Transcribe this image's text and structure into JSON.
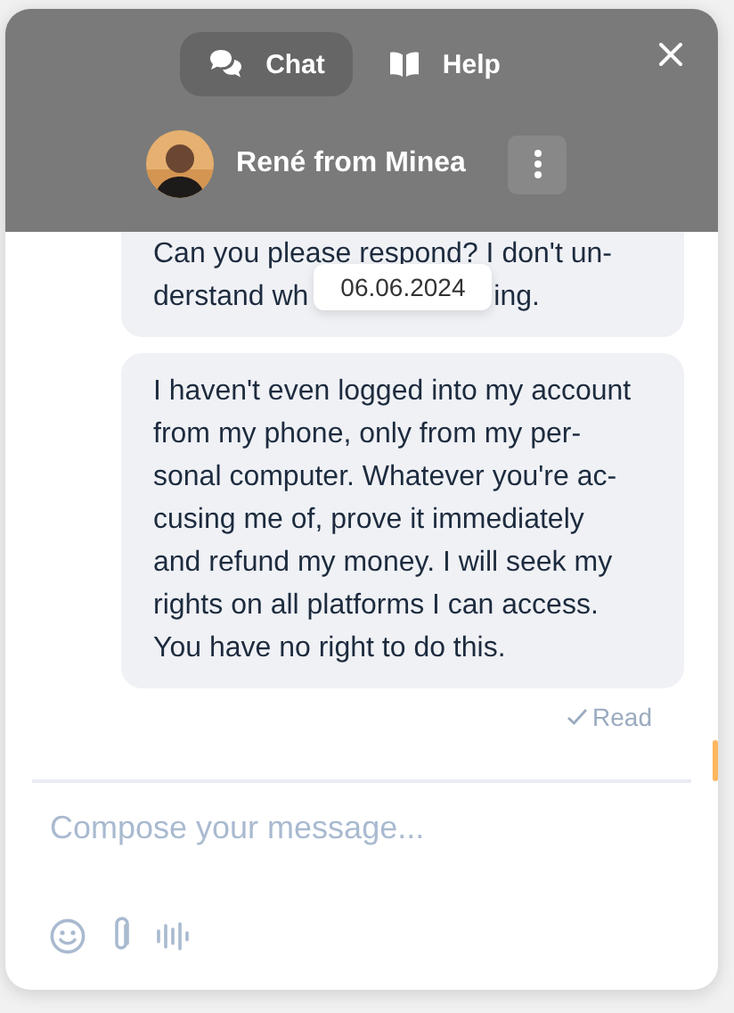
{
  "tabs": [
    {
      "label": "Chat",
      "selected": true
    },
    {
      "label": "Help",
      "selected": false
    }
  ],
  "agent": {
    "name": "René from Minea"
  },
  "messages": [
    {
      "lines": [
        "Can you please respond? I don't un-",
        "derstand wh",
        "ing."
      ],
      "clipped": true
    },
    {
      "lines": [
        "I haven't even logged into my account",
        "from my phone, only from my per-",
        "sonal computer. Whatever you're ac-",
        "cusing me of, prove it immediately",
        "and refund my money. I will seek my",
        "rights on all platforms I can access.",
        "You have no right to do this."
      ],
      "clipped": false
    }
  ],
  "tooltip": "06.06.2024",
  "status": "Read",
  "composer": {
    "placeholder": "Compose your message..."
  }
}
